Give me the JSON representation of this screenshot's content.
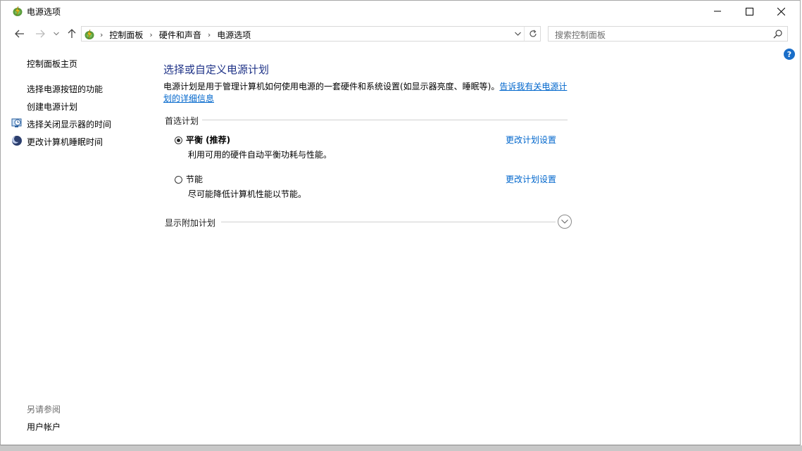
{
  "window": {
    "title": "电源选项",
    "app_icon": "power-options-icon"
  },
  "address_bar": {
    "crumbs": [
      "控制面板",
      "硬件和声音",
      "电源选项"
    ],
    "search_placeholder": "搜索控制面板"
  },
  "left_pane": {
    "home_link": "控制面板主页",
    "links": [
      {
        "label": "选择电源按钮的功能",
        "icon": ""
      },
      {
        "label": "创建电源计划",
        "icon": ""
      },
      {
        "label": "选择关闭显示器的时间",
        "icon": "monitor-clock-icon"
      },
      {
        "label": "更改计算机睡眠时间",
        "icon": "sleep-moon-icon"
      }
    ],
    "see_also": "另请参阅",
    "user_accounts": "用户帐户"
  },
  "main": {
    "heading": "选择或自定义电源计划",
    "description": "电源计划是用于管理计算机如何使用电源的一套硬件和系统设置(如显示器亮度、睡眠等)。",
    "learn_more": "告诉我有关电源计划的详细信息",
    "preferred_label": "首选计划",
    "plans": [
      {
        "name": "平衡 (推荐)",
        "desc": "利用可用的硬件自动平衡功耗与性能。",
        "link": "更改计划设置",
        "selected": true
      },
      {
        "name": "节能",
        "desc": "尽可能降低计算机性能以节能。",
        "link": "更改计划设置",
        "selected": false
      }
    ],
    "additional_label": "显示附加计划"
  },
  "colors": {
    "heading": "#1e3287",
    "link": "#0066cc",
    "help": "#1a6ec8"
  }
}
